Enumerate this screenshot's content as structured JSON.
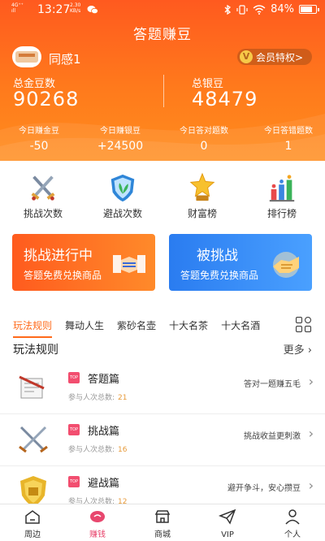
{
  "statusbar": {
    "network": "4G⁺⁺",
    "network_sub": "ıll",
    "time": "13:27",
    "speed_value": "2.30",
    "speed_unit": "KB/s",
    "battery": "84%",
    "battery_level": 0.84
  },
  "header": {
    "title": "答题赚豆",
    "username": "同感1",
    "vip_label": "会员特权>",
    "vip_letter": "V",
    "gold_label": "总金豆数",
    "gold_value": "90268",
    "silver_label": "总银豆",
    "silver_value": "48479",
    "today": [
      {
        "label": "今日赚金豆",
        "value": "-50"
      },
      {
        "label": "今日赚银豆",
        "value": "+24500"
      },
      {
        "label": "今日答对题数",
        "value": "0"
      },
      {
        "label": "今日答错题数",
        "value": "1"
      }
    ]
  },
  "features": [
    {
      "label": "挑战次数",
      "icon": "crossed-swords-icon"
    },
    {
      "label": "避战次数",
      "icon": "shield-icon"
    },
    {
      "label": "财富榜",
      "icon": "star-trophy-icon"
    },
    {
      "label": "排行榜",
      "icon": "ranking-bars-icon"
    }
  ],
  "banners": {
    "left": {
      "title": "挑战进行中",
      "subtitle": "答题免费兑换商品"
    },
    "right": {
      "title": "被挑战",
      "subtitle": "答题免费兑换商品"
    }
  },
  "tabs": [
    "玩法规则",
    "舞动人生",
    "紫砂名壶",
    "十大名茶",
    "十大名酒"
  ],
  "section": {
    "title": "玩法规则",
    "more": "更多"
  },
  "rules": [
    {
      "name": "答题篇",
      "count_label": "参与人次总数:",
      "count": "21",
      "desc": "答对一题赚五毛"
    },
    {
      "name": "挑战篇",
      "count_label": "参与人次总数:",
      "count": "16",
      "desc": "挑战收益更刺激"
    },
    {
      "name": "避战篇",
      "count_label": "参与人次总数:",
      "count": "12",
      "desc": "避开争斗，安心攒豆"
    }
  ],
  "rule_tag": "TOP",
  "bottomnav": [
    "周边",
    "赚钱",
    "商城",
    "VIP",
    "个人"
  ],
  "colors": {
    "primary": "#ff6a1a",
    "nav_active": "#e8476e",
    "blue": "#2a7cf0"
  }
}
